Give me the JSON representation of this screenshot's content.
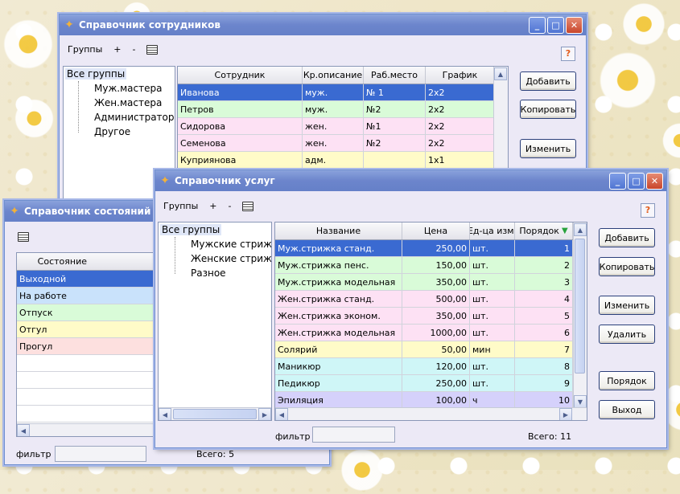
{
  "colors": {
    "selected": "#3a6ad1",
    "pink": "#fde1f4",
    "green": "#d9fbd8",
    "yellow": "#fffbc8",
    "blue": "#c9e2fb",
    "cyan": "#cff6f7",
    "purple": "#d5d1fb",
    "salmon": "#fde0df",
    "title_bar": "#6c85cc"
  },
  "employees": {
    "title": "Справочник сотрудников",
    "toolbar": {
      "groups": "Группы",
      "plus": "+",
      "minus": "-"
    },
    "help": "?",
    "tree": {
      "root": "Все группы",
      "items": [
        "Муж.мастера",
        "Жен.мастера",
        "Администратор",
        "Другое"
      ]
    },
    "columns": [
      "Сотрудник",
      "Кр.описание",
      "Раб.место",
      "График"
    ],
    "rows": [
      {
        "cells": [
          "Иванова",
          "муж.",
          "№ 1",
          "2x2"
        ],
        "color": "selected"
      },
      {
        "cells": [
          "Петров",
          "муж.",
          "№2",
          "2x2"
        ],
        "color": "green"
      },
      {
        "cells": [
          "Сидорова",
          "жен.",
          "№1",
          "2x2"
        ],
        "color": "pink"
      },
      {
        "cells": [
          "Семенова",
          "жен.",
          "№2",
          "2x2"
        ],
        "color": "pink"
      },
      {
        "cells": [
          "Куприянова",
          "адм.",
          "",
          "1x1"
        ],
        "color": "yellow"
      }
    ],
    "buttons": {
      "add": "Добавить",
      "copy": "Копировать",
      "edit": "Изменить"
    }
  },
  "states": {
    "title": "Справочник состояний",
    "column": "Состояние",
    "rows": [
      {
        "label": "Выходной",
        "color": "selected"
      },
      {
        "label": "На работе",
        "color": "blue"
      },
      {
        "label": "Отпуск",
        "color": "green"
      },
      {
        "label": "Отгул",
        "color": "yellow"
      },
      {
        "label": "Прогул",
        "color": "salmon"
      },
      {
        "label": "",
        "color": ""
      },
      {
        "label": "",
        "color": ""
      },
      {
        "label": "",
        "color": ""
      },
      {
        "label": "",
        "color": ""
      }
    ],
    "filter_label": "фильтр",
    "total": "Всего: 5"
  },
  "services": {
    "title": "Справочник услуг",
    "toolbar": {
      "groups": "Группы",
      "plus": "+",
      "minus": "-"
    },
    "help": "?",
    "tree": {
      "root": "Все группы",
      "items": [
        "Мужские стрижки",
        "Женские стрижки",
        "Разное"
      ]
    },
    "columns": [
      "Название",
      "Цена",
      "Ед-ца изм.",
      "Порядок"
    ],
    "sort_arrow": "▼",
    "rows": [
      {
        "cells": [
          "Муж.стрижка станд.",
          "250,00",
          "шт.",
          "1"
        ],
        "color": "selected"
      },
      {
        "cells": [
          "Муж.стрижка пенс.",
          "150,00",
          "шт.",
          "2"
        ],
        "color": "green"
      },
      {
        "cells": [
          "Муж.стрижка модельная",
          "350,00",
          "шт.",
          "3"
        ],
        "color": "green"
      },
      {
        "cells": [
          "Жен.стрижка станд.",
          "500,00",
          "шт.",
          "4"
        ],
        "color": "pink"
      },
      {
        "cells": [
          "Жен.стрижка эконом.",
          "350,00",
          "шт.",
          "5"
        ],
        "color": "pink"
      },
      {
        "cells": [
          "Жен.стрижка модельная",
          "1000,00",
          "шт.",
          "6"
        ],
        "color": "pink"
      },
      {
        "cells": [
          "Солярий",
          "50,00",
          "мин",
          "7"
        ],
        "color": "yellow"
      },
      {
        "cells": [
          "Маникюр",
          "120,00",
          "шт.",
          "8"
        ],
        "color": "cyan"
      },
      {
        "cells": [
          "Педикюр",
          "250,00",
          "шт.",
          "9"
        ],
        "color": "cyan"
      },
      {
        "cells": [
          "Эпиляция",
          "100,00",
          "ч",
          "10"
        ],
        "color": "purple"
      }
    ],
    "buttons": {
      "add": "Добавить",
      "copy": "Копировать",
      "edit": "Изменить",
      "delete": "Удалить",
      "order": "Порядок",
      "exit": "Выход"
    },
    "filter_label": "фильтр",
    "total": "Всего: 11"
  }
}
